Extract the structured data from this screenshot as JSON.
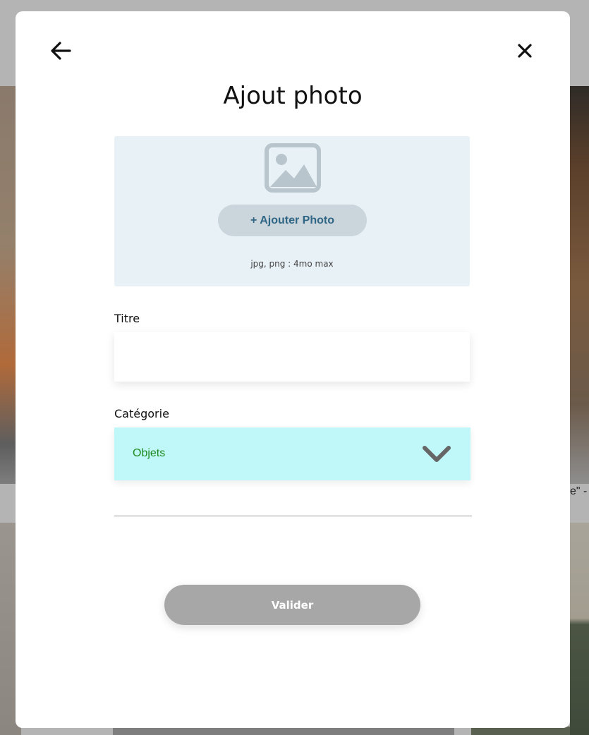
{
  "background": {
    "caption_fragment": "e\" -"
  },
  "modal": {
    "title": "Ajout photo",
    "back_icon": "arrow-left-icon",
    "close_icon": "close-icon",
    "upload": {
      "image_icon": "image-placeholder-icon",
      "add_button_label": "+ Ajouter Photo",
      "hint": "jpg, png : 4mo max"
    },
    "fields": {
      "title_label": "Titre",
      "title_value": "",
      "category_label": "Catégorie",
      "category_value": "Objets",
      "category_icon": "chevron-down-icon"
    },
    "submit_label": "Valider"
  },
  "colors": {
    "upload_bg": "#e8f1f6",
    "add_button_bg": "#cbd6dc",
    "add_button_text": "#306685",
    "select_bg": "#c0f8fa",
    "select_text": "#1d8a1d",
    "submit_bg": "#a7a7a7"
  }
}
